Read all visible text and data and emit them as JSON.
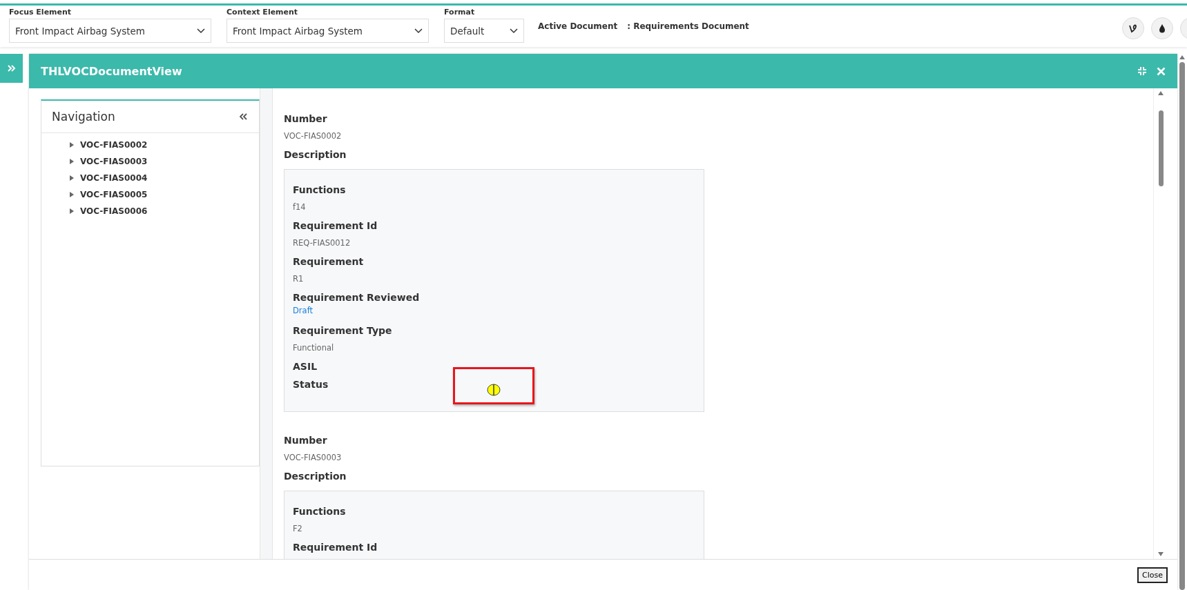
{
  "toolbar": {
    "fields": [
      {
        "label": "Focus Element",
        "value": "Front Impact Airbag System"
      },
      {
        "label": "Context Element",
        "value": "Front Impact Airbag System"
      },
      {
        "label": "Format",
        "value": "Default"
      }
    ],
    "active_document": {
      "label": "Active Document",
      "value": ": Requirements Document"
    }
  },
  "panel": {
    "title": "THLVOCDocumentView"
  },
  "navigation": {
    "title": "Navigation",
    "items": [
      {
        "label": "VOC-FIAS0002",
        "expanded": false
      },
      {
        "label": "VOC-FIAS0003",
        "expanded": false
      },
      {
        "label": "VOC-FIAS0004",
        "expanded": false
      },
      {
        "label": "VOC-FIAS0005",
        "expanded": false
      },
      {
        "label": "VOC-FIAS0006",
        "expanded": false
      }
    ]
  },
  "records": [
    {
      "number_label": "Number",
      "number": "VOC-FIAS0002",
      "description_label": "Description",
      "fields": [
        {
          "label": "Functions",
          "kind": "text",
          "value": "f14"
        },
        {
          "label": "Requirement Id",
          "kind": "text",
          "value": "REQ-FIAS0012"
        },
        {
          "label": "Requirement",
          "kind": "text",
          "value": "R1"
        },
        {
          "label": "Requirement Reviewed",
          "kind": "link",
          "value": "Draft"
        },
        {
          "label": "Requirement Type",
          "kind": "text",
          "value": "Functional"
        },
        {
          "label": "ASIL",
          "kind": "empty"
        },
        {
          "label": "Status",
          "kind": "status",
          "color": "#ffff00",
          "highlighted": true
        }
      ]
    },
    {
      "number_label": "Number",
      "number": "VOC-FIAS0003",
      "description_label": "Description",
      "fields": [
        {
          "label": "Functions",
          "kind": "text",
          "value": "F2"
        },
        {
          "label": "Requirement Id",
          "kind": "empty"
        }
      ]
    }
  ],
  "footer": {
    "button": "Close"
  }
}
